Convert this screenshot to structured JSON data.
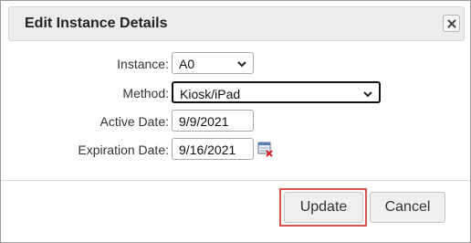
{
  "dialog": {
    "title": "Edit Instance Details"
  },
  "form": {
    "instance": {
      "label": "Instance:",
      "value": "A0"
    },
    "method": {
      "label": "Method:",
      "value": "Kiosk/iPad"
    },
    "active_date": {
      "label": "Active Date:",
      "value": "9/9/2021"
    },
    "expiration_date": {
      "label": "Expiration Date:",
      "value": "9/16/2021"
    }
  },
  "buttons": {
    "update": "Update",
    "cancel": "Cancel"
  },
  "icons": {
    "close": "close-icon",
    "chevron": "chevron-down-icon",
    "calendar_clear": "calendar-clear-icon"
  },
  "colors": {
    "highlight": "#d9534f"
  }
}
